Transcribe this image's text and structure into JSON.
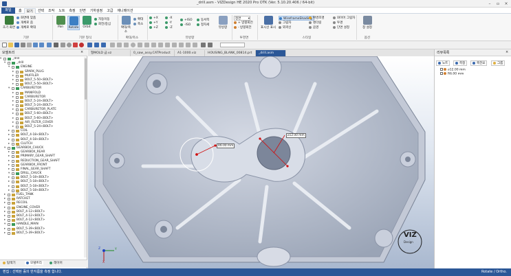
{
  "app": {
    "title": "_drill.asm - VIZDesign HE 2020 Pro OTK (Ver. 5.10.20.406 / 64-bit)"
  },
  "menu": {
    "file_label": "파일",
    "tabs": [
      "홈",
      "보기",
      "선택",
      "조작",
      "노트",
      "측정",
      "단면",
      "기하검정",
      "고급",
      "애니메이션"
    ],
    "active_index": 1
  },
  "ribbon": {
    "groups": [
      {
        "caption": "기본",
        "big": [
          {
            "label": "초기 화면"
          }
        ],
        "small": [
          "화면에 맞춤",
          "개체로 줌",
          "개체로 확대"
        ]
      },
      {
        "caption": "기본 형식",
        "big": [
          {
            "label": "Pan"
          },
          {
            "label": "Rotate"
          },
          {
            "label": "Orbit"
          }
        ],
        "small": [
          "자동이동",
          "회전/중심"
        ]
      },
      {
        "caption": "확대/축소",
        "big": [
          {
            "label": "확대/축소"
          }
        ],
        "small": [
          "확대",
          "축소"
        ]
      },
      {
        "caption": "뷰방향",
        "small": [
          "+X",
          "+Y",
          "+Z",
          "-X",
          "-Y",
          "-Z",
          "+ISO",
          "-ISO",
          "동서쪽",
          "정자세"
        ],
        "big": [
          {
            "label": "뷰방향"
          }
        ]
      },
      {
        "caption": "투영면",
        "small": [
          "정면",
          "+ 방향회전",
          "- 방향회전"
        ]
      },
      {
        "caption": "스타일",
        "big": [
          {
            "label": "표시선 표시"
          }
        ],
        "small": [
          "Wireframe",
          "Shading",
          "그림자",
          "외곽선",
          "환경조명",
          "렌더링",
          "음영",
          "와이어 그림자",
          "투명",
          "단면 설정"
        ]
      },
      {
        "caption": "옵션",
        "big": [
          {
            "label": "창 설정"
          }
        ]
      }
    ]
  },
  "doc_tabs": [
    {
      "label": "형MOLD 금.vz",
      "active": false
    },
    {
      "label": "0_saw_assy.CATProduct",
      "active": false
    },
    {
      "label": "A1-1000.viz",
      "active": false
    },
    {
      "label": "HOUSING_BLANK_00814.prt",
      "active": false
    },
    {
      "label": "_drill.asm",
      "active": true
    }
  ],
  "left_panel": {
    "title": "모델트리",
    "tree": [
      {
        "label": "_drill",
        "level": 0,
        "icon": "assembly"
      },
      {
        "label": "_drill",
        "level": 1,
        "icon": "assembly"
      },
      {
        "label": "ENGINE",
        "level": 2,
        "icon": "assembly"
      },
      {
        "label": "SPARK_PLUG",
        "level": 3,
        "icon": "part"
      },
      {
        "label": "MUFFLER",
        "level": 3,
        "icon": "part"
      },
      {
        "label": "BOLT_5-50<BOLT>",
        "level": 3,
        "icon": "part"
      },
      {
        "label": "BOLT_5-50<BOLT>",
        "level": 3,
        "icon": "part"
      },
      {
        "label": "CARBURETOR",
        "level": 2,
        "icon": "assembly"
      },
      {
        "label": "MANIFOLD",
        "level": 3,
        "icon": "part"
      },
      {
        "label": "CARBURETOR",
        "level": 3,
        "icon": "part"
      },
      {
        "label": "BOLT_5-24<BOLT>",
        "level": 3,
        "icon": "part"
      },
      {
        "label": "BOLT_5-24<BOLT>",
        "level": 3,
        "icon": "part"
      },
      {
        "label": "CARBURETOR_PLATE",
        "level": 3,
        "icon": "part"
      },
      {
        "label": "BOLT_5-60<BOLT>",
        "level": 3,
        "icon": "part"
      },
      {
        "label": "BOLT_5-60<BOLT>",
        "level": 3,
        "icon": "part"
      },
      {
        "label": "AIR_FILTER_COVER",
        "level": 3,
        "icon": "part"
      },
      {
        "label": "BOLT_5-24<BOLT>",
        "level": 3,
        "icon": "part"
      },
      {
        "label": "COIL",
        "level": 2,
        "icon": "part"
      },
      {
        "label": "BOLT_4-18<BOLT>",
        "level": 2,
        "icon": "part"
      },
      {
        "label": "BOLT_4-18<BOLT>",
        "level": 2,
        "icon": "part"
      },
      {
        "label": "CLUTCH",
        "level": 2,
        "icon": "part"
      },
      {
        "label": "GEARBOX_CHUCK",
        "level": 1,
        "icon": "assembly"
      },
      {
        "label": "GEARBOX_REAR",
        "level": 2,
        "icon": "part"
      },
      {
        "label": "PRIMARY_GEAR_SHAFT",
        "level": 2,
        "icon": "part"
      },
      {
        "label": "REDUCTION_GEAR_SHAFT",
        "level": 2,
        "icon": "part"
      },
      {
        "label": "GEARBOX_FRONT",
        "level": 2,
        "icon": "part"
      },
      {
        "label": "FINAL_GEAR_SHAFT",
        "level": 2,
        "icon": "part"
      },
      {
        "label": "DRILL_CHUCK",
        "level": 2,
        "icon": "assembly"
      },
      {
        "label": "BOLT_5-18<BOLT>",
        "level": 2,
        "icon": "part"
      },
      {
        "label": "BOLT_5-18<BOLT>",
        "level": 2,
        "icon": "part"
      },
      {
        "label": "BOLT_5-18<BOLT>",
        "level": 2,
        "icon": "part"
      },
      {
        "label": "BOLT_5-18<BOLT>",
        "level": 2,
        "icon": "part"
      },
      {
        "label": "FUEL_TANK",
        "level": 1,
        "icon": "part"
      },
      {
        "label": "RATCHET",
        "level": 1,
        "icon": "part"
      },
      {
        "label": "RECOIL",
        "level": 1,
        "icon": "part"
      },
      {
        "label": "ENGINE_COVER",
        "level": 1,
        "icon": "part"
      },
      {
        "label": "BOLT_4-12<BOLT>",
        "level": 1,
        "icon": "part"
      },
      {
        "label": "BOLT_4-12<BOLT>",
        "level": 1,
        "icon": "part"
      },
      {
        "label": "BOLT_4-12<BOLT>",
        "level": 1,
        "icon": "part"
      },
      {
        "label": "HANDLE_MAIN",
        "level": 1,
        "icon": "assembly"
      },
      {
        "label": "BOLT_5-39<BOLT>",
        "level": 1,
        "icon": "part"
      },
      {
        "label": "BOLT_5-39<BOLT>",
        "level": 1,
        "icon": "part"
      }
    ],
    "bottom_tabs": [
      "탐색기",
      "모델트리",
      "레이어"
    ]
  },
  "viewport": {
    "dimension_left": "R6.00 mm",
    "dimension_right": "⌀12.00 mm",
    "logo_text": "VIZ",
    "logo_sub": "Design",
    "axis_x": "X",
    "axis_y": "Y",
    "axis_z": "Z"
  },
  "right_panel": {
    "title": "리뷰목록",
    "buttons": [
      "노트",
      "측정",
      "축전요",
      "그룹"
    ],
    "items": [
      "⌀12.00 mm",
      "R6.00 mm"
    ]
  },
  "status": {
    "left": "펀집 : 선택된 홀의 반지름을 측정 합니다.",
    "right": "Rotate / Ortho."
  },
  "colors": {
    "accent": "#2b5797",
    "model": "#b4bccc",
    "dimension": "#d01010"
  }
}
